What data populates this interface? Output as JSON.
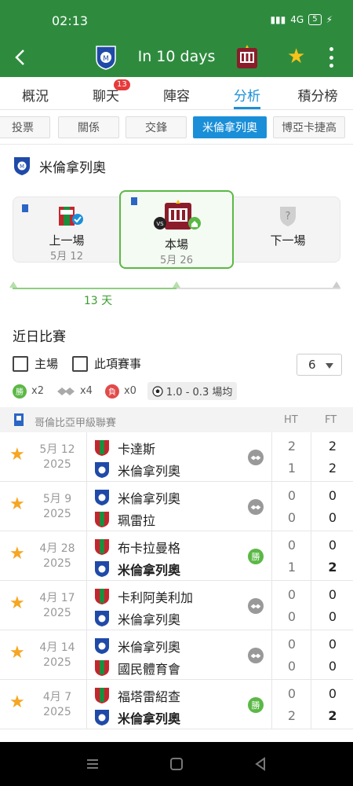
{
  "status_bar": {
    "time": "02:13",
    "network": "4G",
    "battery": "5"
  },
  "header": {
    "title": "In 10 days",
    "home_team_icon": "millonarios-crest",
    "away_team_icon": "boyaca-crest",
    "favorite": true
  },
  "tabs": [
    {
      "label": "概況"
    },
    {
      "label": "聊天",
      "badge": "13"
    },
    {
      "label": "陣容"
    },
    {
      "label": "分析",
      "active": true
    },
    {
      "label": "積分榜"
    }
  ],
  "subtabs": [
    {
      "label": "投票"
    },
    {
      "label": "關係"
    },
    {
      "label": "交鋒"
    },
    {
      "label": "米倫拿列奧",
      "active": true
    },
    {
      "label": "博亞卡捷高"
    }
  ],
  "team_section": {
    "team_name": "米倫拿列奧"
  },
  "timeline": {
    "previous": {
      "label": "上一場",
      "date": "5月 12"
    },
    "current": {
      "label": "本場",
      "date": "5月 26"
    },
    "next": {
      "label": "下一場"
    },
    "days_label": "13 天"
  },
  "recent": {
    "title": "近日比賽",
    "filter_home": "主場",
    "filter_competition": "此項賽事",
    "count_selected": "6",
    "stats": {
      "wins": "x2",
      "draws": "x4",
      "losses": "x0",
      "win_glyph": "勝",
      "loss_glyph": "負",
      "goal_avg": "1.0 - 0.3 場均"
    },
    "league_name": "哥倫比亞甲級聯賽",
    "col_ht": "HT",
    "col_ft": "FT",
    "matches": [
      {
        "date": "5月 12",
        "year": "2025",
        "team1": "卡達斯",
        "team2": "米倫拿列奧",
        "ht1": "2",
        "ht2": "1",
        "ft1": "2",
        "ft2": "2",
        "result": "draw",
        "result_label": "",
        "bold_team": ""
      },
      {
        "date": "5月 9",
        "year": "2025",
        "team1": "米倫拿列奧",
        "team2": "珮雷拉",
        "ht1": "0",
        "ht2": "0",
        "ft1": "0",
        "ft2": "0",
        "result": "draw",
        "result_label": "",
        "bold_team": ""
      },
      {
        "date": "4月 28",
        "year": "2025",
        "team1": "布卡拉曼格",
        "team2": "米倫拿列奧",
        "ht1": "0",
        "ht2": "1",
        "ft1": "0",
        "ft2": "2",
        "result": "win",
        "result_label": "勝",
        "bold_team": "2"
      },
      {
        "date": "4月 17",
        "year": "2025",
        "team1": "卡利阿美利加",
        "team2": "米倫拿列奧",
        "ht1": "0",
        "ht2": "0",
        "ft1": "0",
        "ft2": "0",
        "result": "draw",
        "result_label": "",
        "bold_team": ""
      },
      {
        "date": "4月 14",
        "year": "2025",
        "team1": "米倫拿列奧",
        "team2": "國民體育會",
        "ht1": "0",
        "ht2": "0",
        "ft1": "0",
        "ft2": "0",
        "result": "draw",
        "result_label": "",
        "bold_team": ""
      },
      {
        "date": "4月 7",
        "year": "2025",
        "team1": "福塔雷紹查",
        "team2": "米倫拿列奧",
        "ht1": "0",
        "ht2": "2",
        "ft1": "0",
        "ft2": "2",
        "result": "win",
        "result_label": "勝",
        "bold_team": "2"
      }
    ]
  },
  "colors": {
    "primary_green": "#2e8b3e",
    "accent_blue": "#1a8fd8",
    "win_green": "#5bb846",
    "star_yellow": "#f7c31a"
  }
}
